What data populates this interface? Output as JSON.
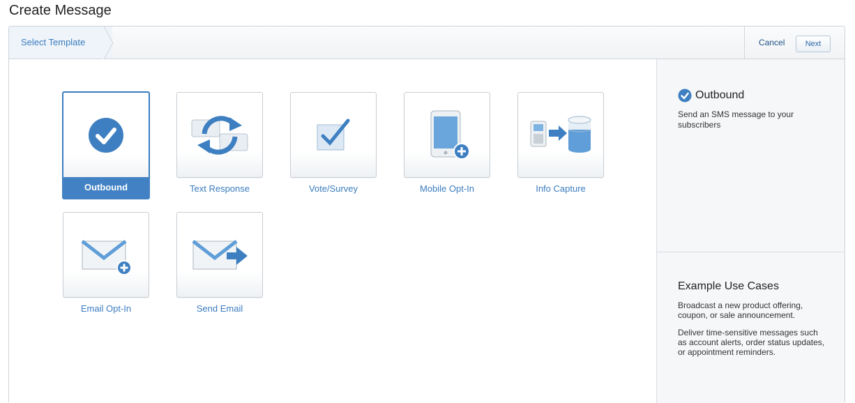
{
  "page": {
    "title": "Create Message"
  },
  "toolbar": {
    "step_label": "Select Template",
    "cancel_label": "Cancel",
    "next_label": "Next"
  },
  "templates": [
    {
      "label": "Outbound",
      "icon": "check-circle-icon",
      "selected": true
    },
    {
      "label": "Text Response",
      "icon": "chat-refresh-icon",
      "selected": false
    },
    {
      "label": "Vote/Survey",
      "icon": "checkbox-icon",
      "selected": false
    },
    {
      "label": "Mobile Opt-In",
      "icon": "phone-plus-icon",
      "selected": false
    },
    {
      "label": "Info Capture",
      "icon": "phone-database-icon",
      "selected": false
    },
    {
      "label": "Email Opt-In",
      "icon": "envelope-plus-icon",
      "selected": false
    },
    {
      "label": "Send Email",
      "icon": "envelope-arrow-icon",
      "selected": false
    }
  ],
  "sidebar": {
    "title": "Outbound",
    "description": "Send an SMS message to your subscribers",
    "use_cases_title": "Example Use Cases",
    "use_cases": [
      "Broadcast a new product offering, coupon, or sale announcement.",
      "Deliver time-sensitive messages such as account alerts, order status updates, or appointment reminders."
    ]
  },
  "colors": {
    "accent": "#4282c4",
    "link": "#3b7cbf"
  }
}
